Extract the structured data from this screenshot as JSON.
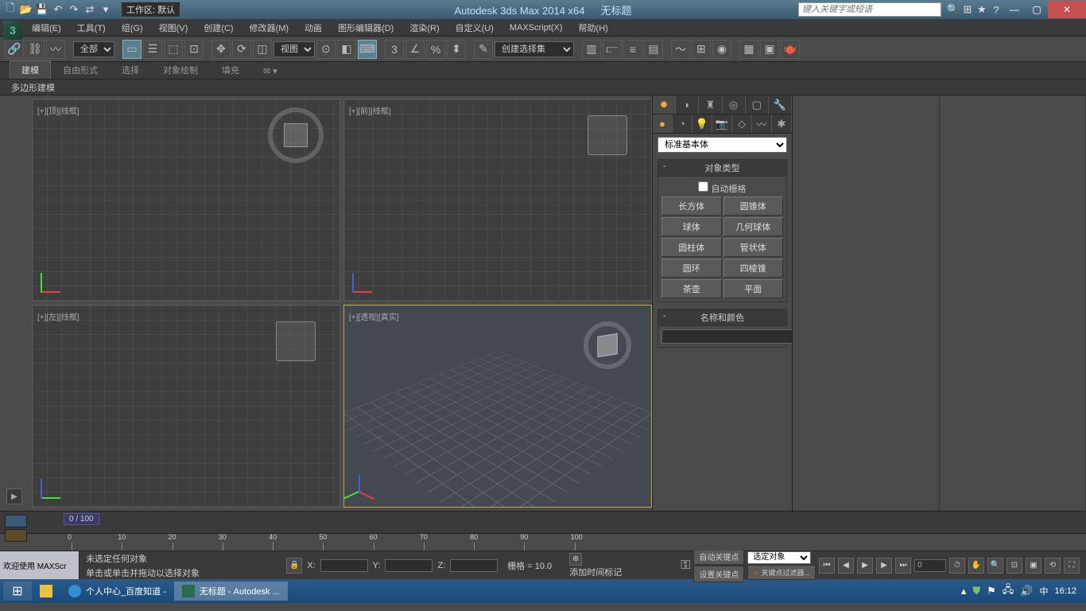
{
  "titlebar": {
    "workspace": "工作区: 默认",
    "app_title": "Autodesk 3ds Max  2014 x64",
    "doc_title": "无标题",
    "search_placeholder": "键入关键字或短语"
  },
  "menu": {
    "items": [
      "编辑(E)",
      "工具(T)",
      "组(G)",
      "视图(V)",
      "创建(C)",
      "修改器(M)",
      "动画",
      "图形编辑器(D)",
      "渲染(R)",
      "自定义(U)",
      "MAXScript(X)",
      "帮助(H)"
    ]
  },
  "toolbar": {
    "filter_all": "全部",
    "ref_coord": "视图",
    "named_sel": "创建选择集"
  },
  "ribbon": {
    "tabs": [
      "建模",
      "自由形式",
      "选择",
      "对象绘制",
      "填充"
    ],
    "sub": "多边形建模"
  },
  "viewports": {
    "top": "[+][顶][线框]",
    "front": "[+][前][线框]",
    "left": "[+][左][线框]",
    "persp": "[+][透视][真实]"
  },
  "command": {
    "category": "标准基本体",
    "rollout_obj_type": "对象类型",
    "auto_grid": "自动栅格",
    "objects": [
      "长方体",
      "圆锥体",
      "球体",
      "几何球体",
      "圆柱体",
      "管状体",
      "圆环",
      "四棱锥",
      "茶壶",
      "平面"
    ],
    "rollout_name": "名称和颜色"
  },
  "timeline": {
    "frame": "0 / 100",
    "ticks": [
      "0",
      "10",
      "20",
      "30",
      "40",
      "50",
      "60",
      "70",
      "80",
      "90",
      "100"
    ]
  },
  "status": {
    "welcome": "欢迎使用  MAXScr",
    "no_sel": "未选定任何对象",
    "hint": "单击或单击并拖动以选择对象",
    "x": "X:",
    "y": "Y:",
    "z": "Z:",
    "grid": "栅格 = 10.0",
    "add_time": "添加时间标记",
    "auto_key": "自动关键点",
    "set_key": "设置关键点",
    "sel_obj": "选定对象",
    "key_filter": "关键点过滤器..."
  },
  "taskbar": {
    "items": [
      "个人中心_百度知道 - ",
      "无标题 - Autodesk ..."
    ],
    "time": "16:12",
    "ime": "中"
  }
}
